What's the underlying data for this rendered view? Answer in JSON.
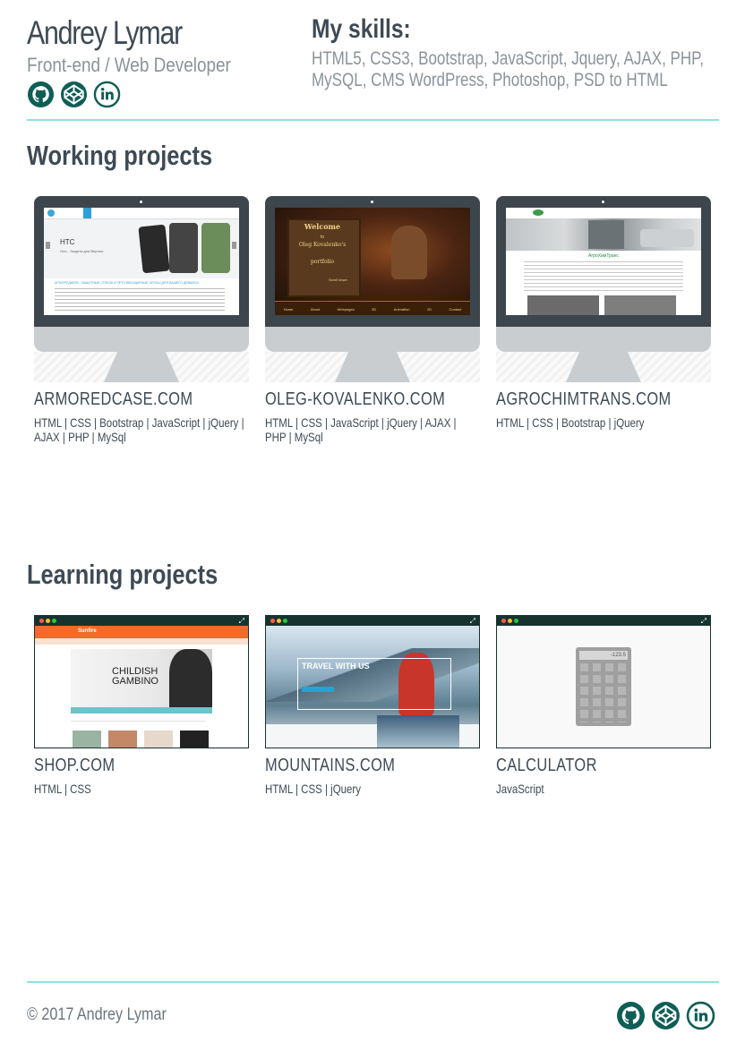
{
  "header": {
    "name": "Andrey Lymar",
    "role": "Front-end / Web Developer",
    "social": [
      {
        "icon": "github-icon"
      },
      {
        "icon": "codepen-icon"
      },
      {
        "icon": "linkedin-icon"
      }
    ]
  },
  "skills": {
    "title": "My skills:",
    "text": "HTML5, CSS3, Bootstrap, JavaScript, Jquery, AJAX, PHP, MySQL, CMS WordPress, Photoshop, PSD to HTML"
  },
  "working": {
    "title": "Working projects",
    "projects": [
      {
        "title": "ARMOREDCASE.COM",
        "tech": "HTML | CSS | Bootstrap | JavaScript | jQuery | AJAX | PHP | MySql",
        "screen": {
          "heading": "HTC",
          "subheading": "One - Защита для Верных",
          "banner": "АРМОРЕДКЕЙС, ЗАЩИТНЫЕ СТЕКЛА И ПРОТИВОУДАРНЫЕ ЧЕХЛЫ ДЛЯ ВАШЕГО ДЕВАЙСА"
        }
      },
      {
        "title": "OLEG-KOVALENKO.COM",
        "tech": "HTML | CSS | JavaScript | jQuery | AJAX | PHP | MySql",
        "screen": {
          "sign1": "Welcome",
          "sign2": "to",
          "sign3": "Oleg Kovalenko's",
          "sign4": "portfolio",
          "scroll": "Scroll down",
          "nav": [
            "Home",
            "About",
            "Webpages",
            "3D",
            "Animation",
            "2D",
            "Contact"
          ]
        }
      },
      {
        "title": "AGROCHIMTRANS.COM",
        "tech": "HTML | CSS | Bootstrap | jQuery",
        "screen": {
          "heading": "АгроХимТранс"
        }
      }
    ]
  },
  "learning": {
    "title": "Learning projects",
    "projects": [
      {
        "title": "SHOP.COM",
        "tech": "HTML | CSS",
        "screen": {
          "brand": "Sunfire",
          "hero1": "CHILDISH",
          "hero2": "GAMBINO"
        }
      },
      {
        "title": "MOUNTAINS.COM",
        "tech": "HTML | CSS | jQuery",
        "screen": {
          "hero": "TRAVEL WITH US"
        }
      },
      {
        "title": "CALCULATOR",
        "tech": "JavaScript",
        "screen": {
          "display": "-123.5"
        }
      }
    ]
  },
  "footer": {
    "copyright": "© 2017 Andrey Lymar"
  },
  "colors": {
    "accent": "#0f5e56",
    "rule": "#8ee2dc",
    "text": "#3e4a55",
    "muted": "#8b9399"
  }
}
